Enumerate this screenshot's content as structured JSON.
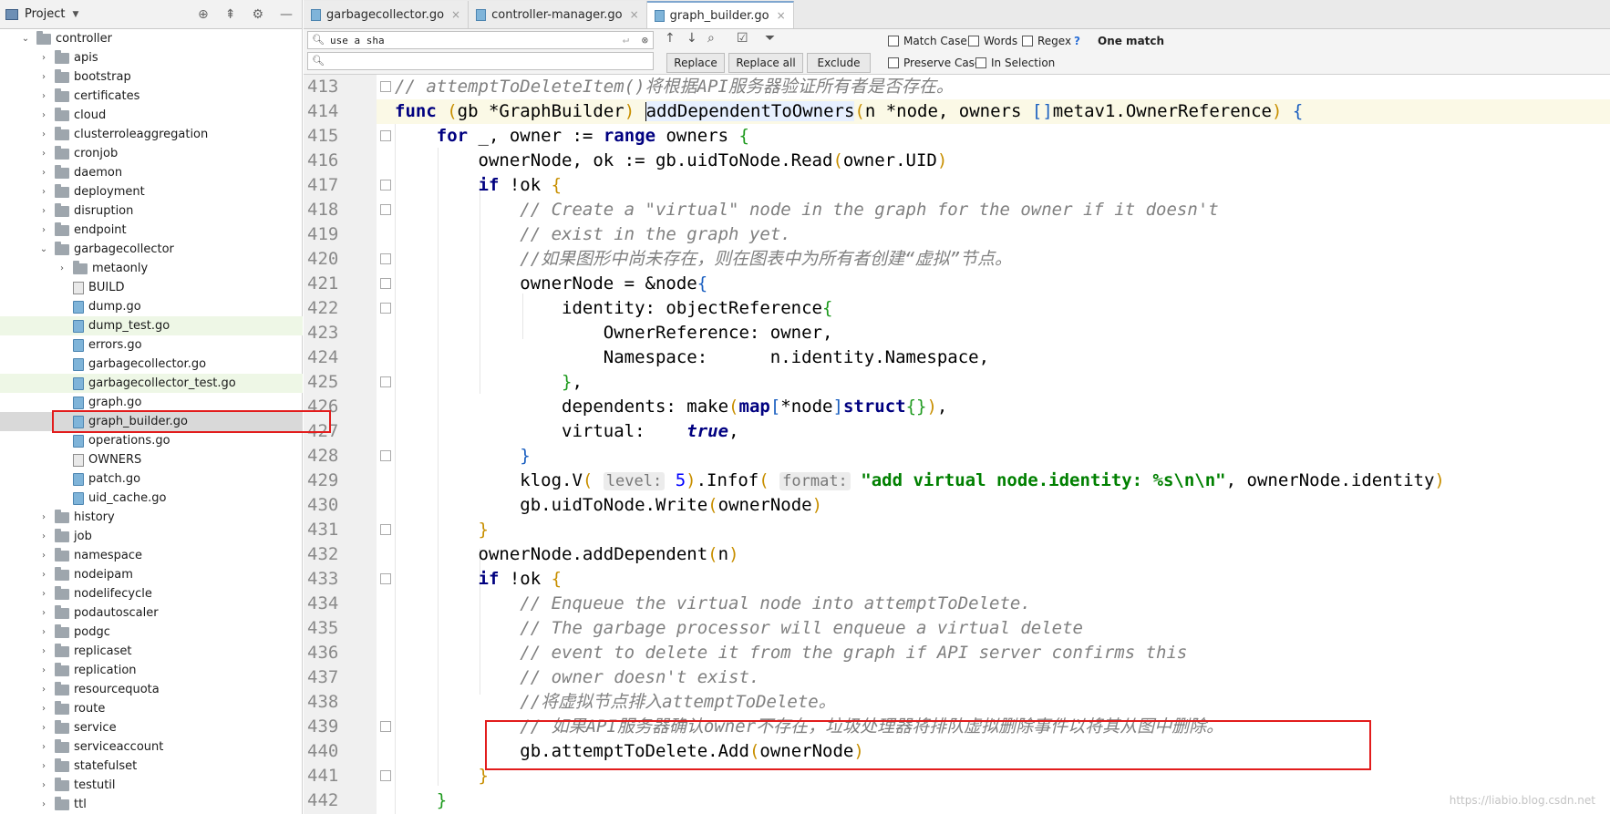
{
  "project_panel": {
    "title": "Project",
    "tree": [
      {
        "label": "controller",
        "kind": "folder",
        "depth": 0,
        "expanded": true
      },
      {
        "label": "apis",
        "kind": "folder",
        "depth": 1
      },
      {
        "label": "bootstrap",
        "kind": "folder",
        "depth": 1
      },
      {
        "label": "certificates",
        "kind": "folder",
        "depth": 1
      },
      {
        "label": "cloud",
        "kind": "folder",
        "depth": 1
      },
      {
        "label": "clusterroleaggregation",
        "kind": "folder",
        "depth": 1
      },
      {
        "label": "cronjob",
        "kind": "folder",
        "depth": 1
      },
      {
        "label": "daemon",
        "kind": "folder",
        "depth": 1
      },
      {
        "label": "deployment",
        "kind": "folder",
        "depth": 1
      },
      {
        "label": "disruption",
        "kind": "folder",
        "depth": 1
      },
      {
        "label": "endpoint",
        "kind": "folder",
        "depth": 1
      },
      {
        "label": "garbagecollector",
        "kind": "folder",
        "depth": 1,
        "expanded": true
      },
      {
        "label": "metaonly",
        "kind": "folder",
        "depth": 2
      },
      {
        "label": "BUILD",
        "kind": "plain",
        "depth": 2
      },
      {
        "label": "dump.go",
        "kind": "go",
        "depth": 2
      },
      {
        "label": "dump_test.go",
        "kind": "go",
        "depth": 2,
        "highlight": true
      },
      {
        "label": "errors.go",
        "kind": "go",
        "depth": 2
      },
      {
        "label": "garbagecollector.go",
        "kind": "go",
        "depth": 2
      },
      {
        "label": "garbagecollector_test.go",
        "kind": "go",
        "depth": 2,
        "highlight": true
      },
      {
        "label": "graph.go",
        "kind": "go",
        "depth": 2
      },
      {
        "label": "graph_builder.go",
        "kind": "go",
        "depth": 2,
        "selected": true
      },
      {
        "label": "operations.go",
        "kind": "go",
        "depth": 2
      },
      {
        "label": "OWNERS",
        "kind": "plain",
        "depth": 2
      },
      {
        "label": "patch.go",
        "kind": "go",
        "depth": 2
      },
      {
        "label": "uid_cache.go",
        "kind": "go",
        "depth": 2
      },
      {
        "label": "history",
        "kind": "folder",
        "depth": 1
      },
      {
        "label": "job",
        "kind": "folder",
        "depth": 1
      },
      {
        "label": "namespace",
        "kind": "folder",
        "depth": 1
      },
      {
        "label": "nodeipam",
        "kind": "folder",
        "depth": 1
      },
      {
        "label": "nodelifecycle",
        "kind": "folder",
        "depth": 1
      },
      {
        "label": "podautoscaler",
        "kind": "folder",
        "depth": 1
      },
      {
        "label": "podgc",
        "kind": "folder",
        "depth": 1
      },
      {
        "label": "replicaset",
        "kind": "folder",
        "depth": 1
      },
      {
        "label": "replication",
        "kind": "folder",
        "depth": 1
      },
      {
        "label": "resourcequota",
        "kind": "folder",
        "depth": 1
      },
      {
        "label": "route",
        "kind": "folder",
        "depth": 1
      },
      {
        "label": "service",
        "kind": "folder",
        "depth": 1
      },
      {
        "label": "serviceaccount",
        "kind": "folder",
        "depth": 1
      },
      {
        "label": "statefulset",
        "kind": "folder",
        "depth": 1
      },
      {
        "label": "testutil",
        "kind": "folder",
        "depth": 1
      },
      {
        "label": "ttl",
        "kind": "folder",
        "depth": 1
      }
    ]
  },
  "tabs": [
    {
      "label": "garbagecollector.go",
      "active": false
    },
    {
      "label": "controller-manager.go",
      "active": false
    },
    {
      "label": "graph_builder.go",
      "active": true
    }
  ],
  "find": {
    "search_value": "use a sha",
    "replace_value": "",
    "replace_label": "Replace",
    "replace_all_label": "Replace all",
    "exclude_label": "Exclude",
    "match_case": "Match Case",
    "words": "Words",
    "regex": "Regex",
    "help": "?",
    "preserve_case": "Preserve Case",
    "in_selection": "In Selection",
    "result": "One match"
  },
  "editor": {
    "line_numbers": [
      "413",
      "414",
      "415",
      "416",
      "417",
      "418",
      "419",
      "420",
      "421",
      "422",
      "423",
      "424",
      "425",
      "426",
      "427",
      "428",
      "429",
      "430",
      "431",
      "432",
      "433",
      "434",
      "435",
      "436",
      "437",
      "438",
      "439",
      "440",
      "441",
      "442"
    ],
    "hint_level": "level:",
    "hint_format": "format:"
  },
  "watermark": "https://liabio.blog.csdn.net"
}
